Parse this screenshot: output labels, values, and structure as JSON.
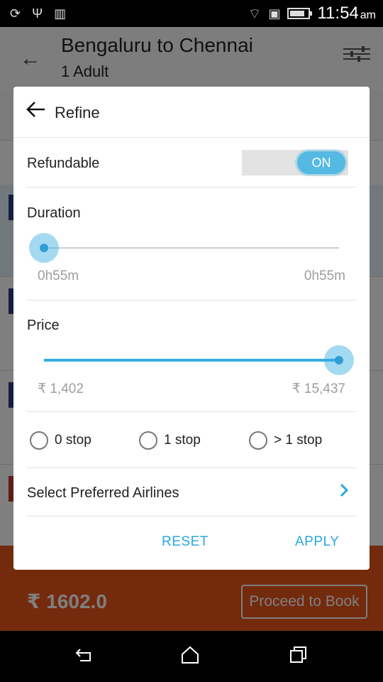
{
  "status_bar": {
    "time": "11:54",
    "ampm": "am"
  },
  "app_header": {
    "title": "Bengaluru to Chennai",
    "subtitle": "1 Adult"
  },
  "bottom_bar": {
    "price": "₹ 1602.0",
    "proceed_label": "Proceed to Book"
  },
  "dialog": {
    "title": "Refine",
    "refundable_label": "Refundable",
    "refundable_toggle": "ON",
    "duration": {
      "label": "Duration",
      "min_label": "0h55m",
      "max_label": "0h55m",
      "selected_fraction": 0.0
    },
    "price": {
      "label": "Price",
      "min_label": "₹ 1,402",
      "max_label": "₹ 15,437",
      "selected_min_fraction": 0.0,
      "selected_max_fraction": 1.0
    },
    "stops": [
      {
        "label": "0 stop",
        "checked": false
      },
      {
        "label": "1 stop",
        "checked": false
      },
      {
        "label": "> 1 stop",
        "checked": false
      }
    ],
    "preferred_airlines_label": "Select Preferred Airlines",
    "reset_label": "RESET",
    "apply_label": "APPLY"
  },
  "colors": {
    "accent": "#35ADE1",
    "primary_orange": "#E8541A"
  }
}
